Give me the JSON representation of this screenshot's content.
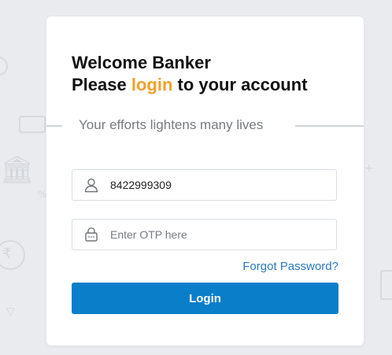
{
  "header": {
    "line1": "Welcome Banker",
    "line2_prefix": "Please ",
    "line2_highlight": "login",
    "line2_suffix": " to your account"
  },
  "tagline": "Your efforts lightens many lives",
  "username": {
    "value": "8422999309",
    "icon": "user-icon"
  },
  "otp": {
    "placeholder": "Enter OTP here",
    "value": "",
    "icon": "lock-icon"
  },
  "forgot_password_label": "Forgot Password?",
  "login_label": "Login",
  "colors": {
    "accent": "#f0a02a",
    "primary": "#0a7ec9",
    "link": "#2a78bd",
    "background": "#e9ebee"
  }
}
